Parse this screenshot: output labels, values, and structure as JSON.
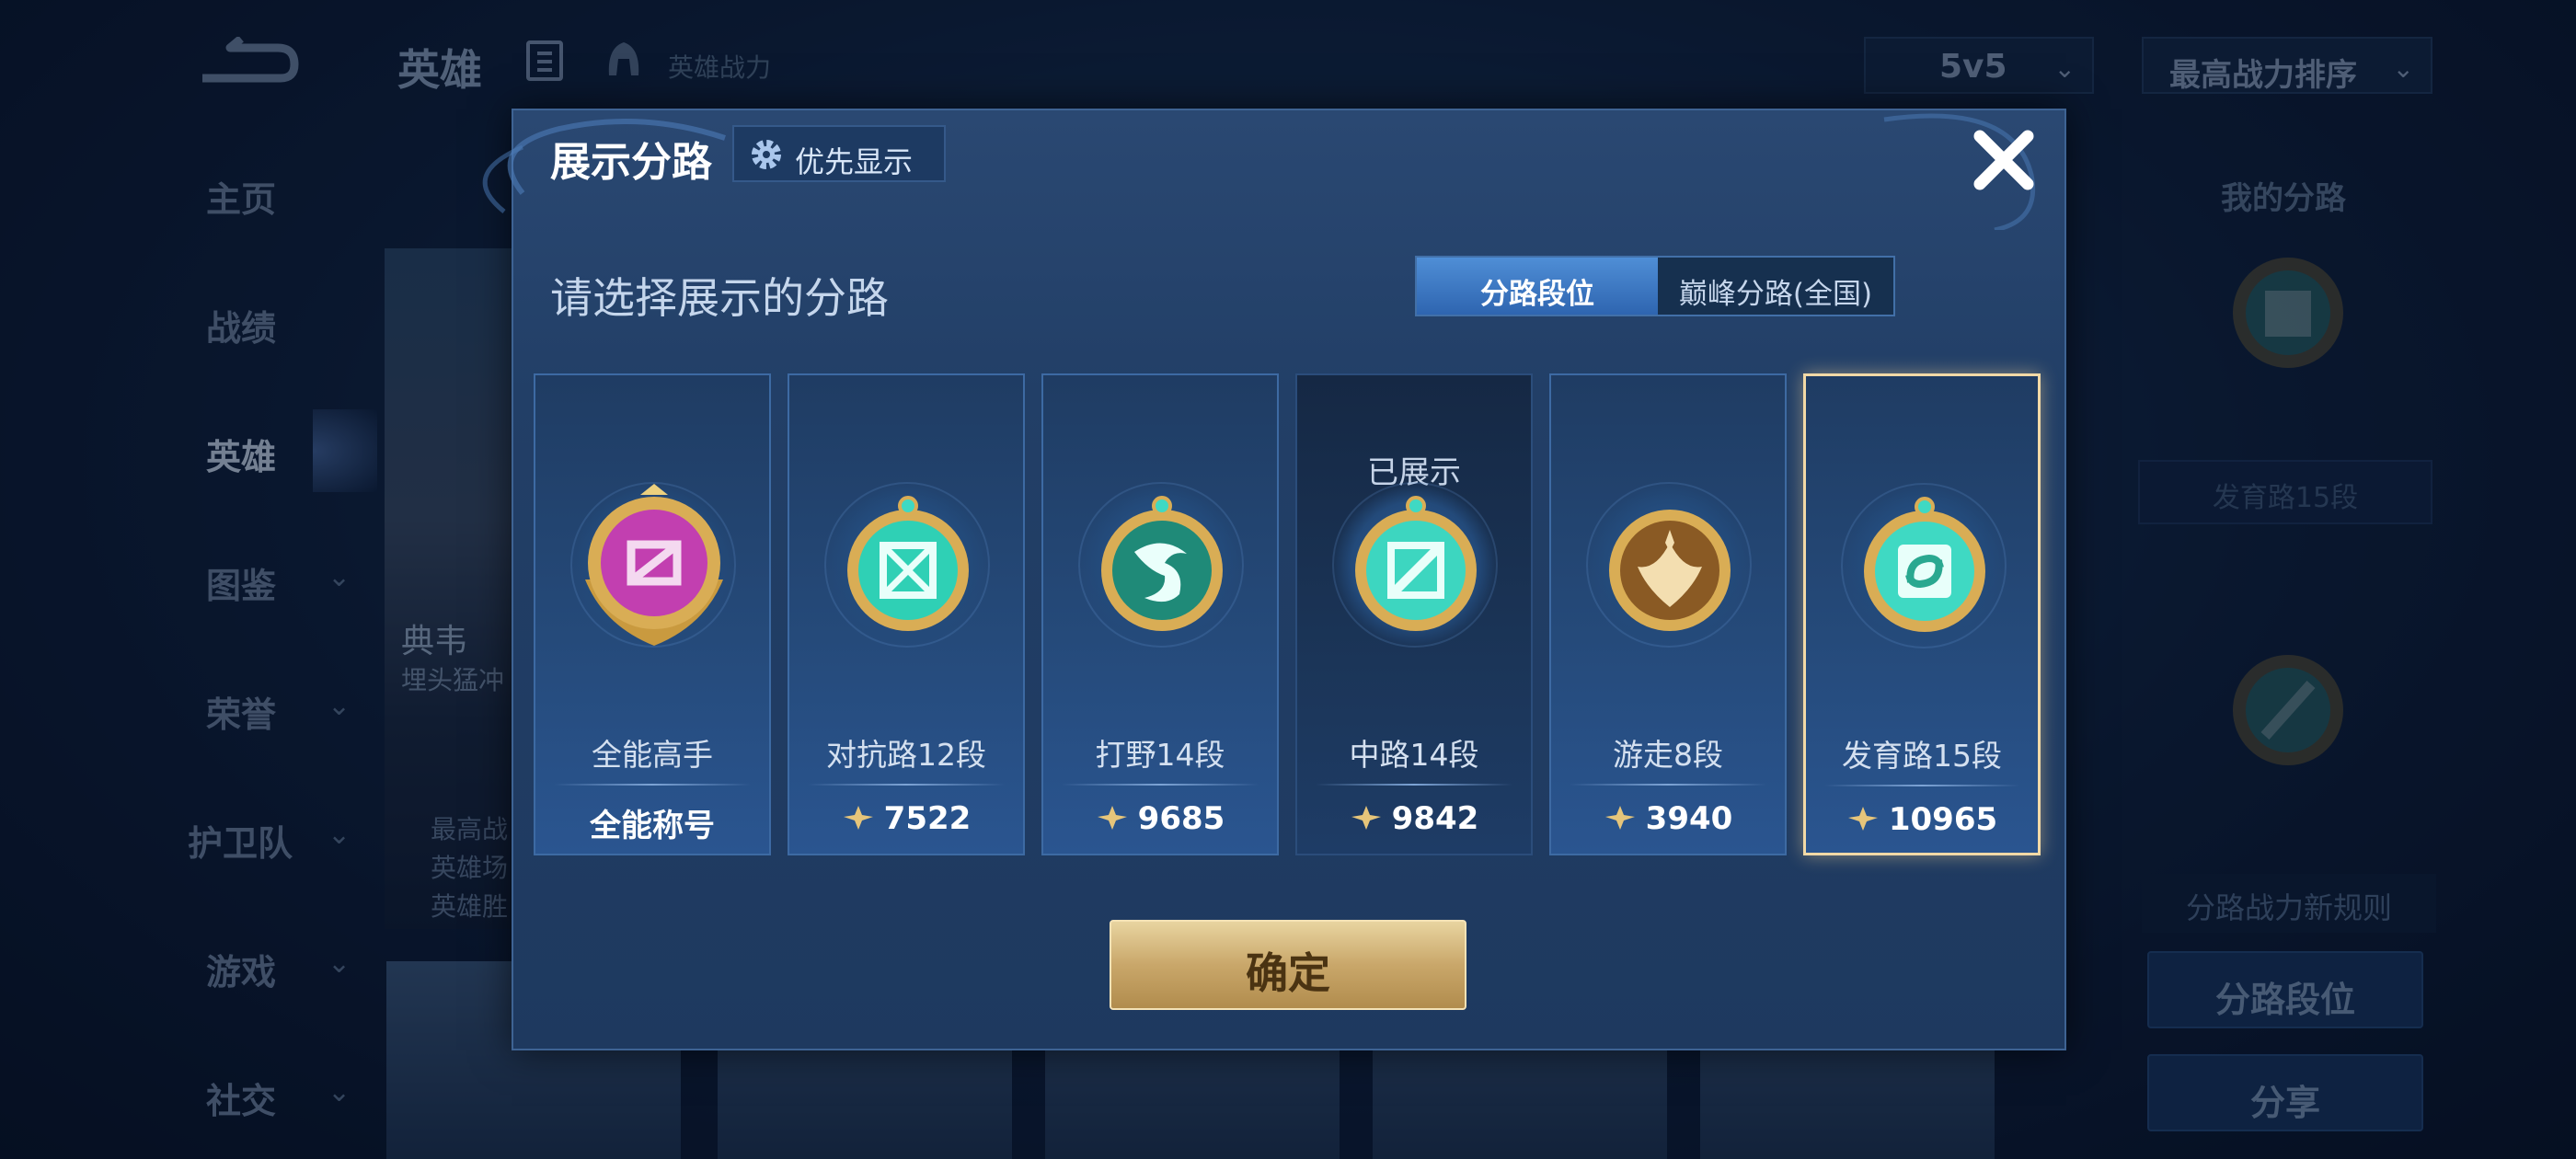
{
  "topbar": {
    "title": "英雄",
    "power_label": "英雄战力",
    "mode_value": "5v5",
    "sort_value": "最高战力排序"
  },
  "nav": [
    {
      "label": "主页"
    },
    {
      "label": "战绩"
    },
    {
      "label": "英雄"
    },
    {
      "label": "图鉴"
    },
    {
      "label": "荣誉"
    },
    {
      "label": "护卫队"
    },
    {
      "label": "游戏"
    },
    {
      "label": "社交"
    }
  ],
  "hero_card": {
    "name": "典韦",
    "title": "埋头猛冲",
    "stats": [
      "最高战",
      "英雄场",
      "英雄胜"
    ]
  },
  "right_panel": {
    "title": "我的分路",
    "lane_rank": "发育路15段",
    "rule_text": "分路战力新规则",
    "lane_button": "分路段位",
    "share_button": "分享"
  },
  "modal": {
    "title": "展示分路",
    "priority_label": "优先显示",
    "prompt": "请选择展示的分路",
    "tabs": [
      {
        "label": "分路段位",
        "active": true
      },
      {
        "label": "巅峰分路(全国)",
        "active": false
      }
    ],
    "shown_tag": "已展示",
    "lanes": [
      {
        "name": "全能高手",
        "value": "全能称号",
        "badge": "all-round-badge",
        "color": "#c23fb0"
      },
      {
        "name": "对抗路12段",
        "value": "7522",
        "badge": "clash-lane-badge",
        "color": "#2fd0b5"
      },
      {
        "name": "打野14段",
        "value": "9685",
        "badge": "jungle-badge",
        "color": "#2aa88f"
      },
      {
        "name": "中路14段",
        "value": "9842",
        "badge": "mid-lane-badge",
        "color": "#3dd6c0"
      },
      {
        "name": "游走8段",
        "value": "3940",
        "badge": "roam-badge",
        "color": "#b8823a"
      },
      {
        "name": "发育路15段",
        "value": "10965",
        "badge": "farm-lane-badge",
        "color": "#3fd9c3"
      }
    ],
    "confirm_label": "确定"
  }
}
